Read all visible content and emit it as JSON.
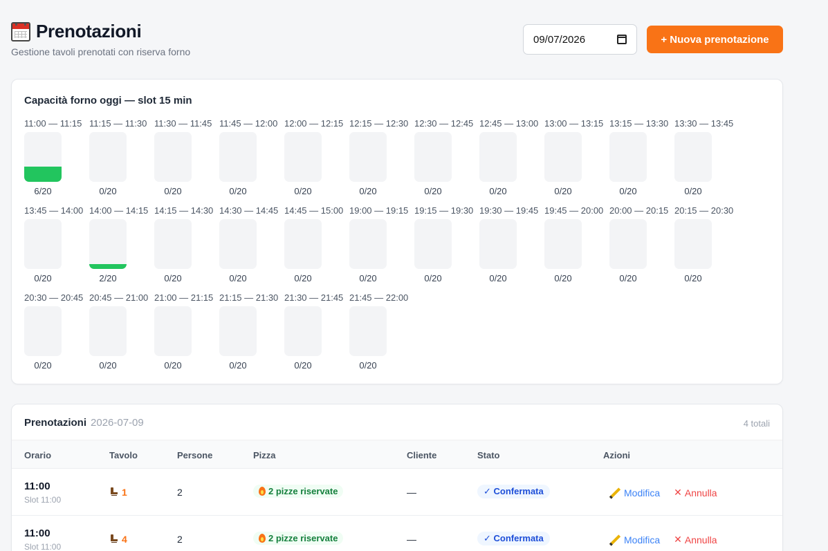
{
  "header": {
    "title": "Prenotazioni",
    "subtitle": "Gestione tavoli prenotati con riserva forno",
    "date_value": "09/07/2026",
    "new_button": "+ Nuova prenotazione"
  },
  "oven": {
    "title": "Capacità forno oggi — slot 15 min",
    "capacity": 20,
    "slots": [
      {
        "label": "11:00 — 11:15",
        "used": 6,
        "count": "6/20"
      },
      {
        "label": "11:15 — 11:30",
        "used": 0,
        "count": "0/20"
      },
      {
        "label": "11:30 — 11:45",
        "used": 0,
        "count": "0/20"
      },
      {
        "label": "11:45 — 12:00",
        "used": 0,
        "count": "0/20"
      },
      {
        "label": "12:00 — 12:15",
        "used": 0,
        "count": "0/20"
      },
      {
        "label": "12:15 — 12:30",
        "used": 0,
        "count": "0/20"
      },
      {
        "label": "12:30 — 12:45",
        "used": 0,
        "count": "0/20"
      },
      {
        "label": "12:45 — 13:00",
        "used": 0,
        "count": "0/20"
      },
      {
        "label": "13:00 — 13:15",
        "used": 0,
        "count": "0/20"
      },
      {
        "label": "13:15 — 13:30",
        "used": 0,
        "count": "0/20"
      },
      {
        "label": "13:30 — 13:45",
        "used": 0,
        "count": "0/20"
      },
      {
        "label": "13:45 — 14:00",
        "used": 0,
        "count": "0/20"
      },
      {
        "label": "14:00 — 14:15",
        "used": 2,
        "count": "2/20"
      },
      {
        "label": "14:15 — 14:30",
        "used": 0,
        "count": "0/20"
      },
      {
        "label": "14:30 — 14:45",
        "used": 0,
        "count": "0/20"
      },
      {
        "label": "14:45 — 15:00",
        "used": 0,
        "count": "0/20"
      },
      {
        "label": "19:00 — 19:15",
        "used": 0,
        "count": "0/20"
      },
      {
        "label": "19:15 — 19:30",
        "used": 0,
        "count": "0/20"
      },
      {
        "label": "19:30 — 19:45",
        "used": 0,
        "count": "0/20"
      },
      {
        "label": "19:45 — 20:00",
        "used": 0,
        "count": "0/20"
      },
      {
        "label": "20:00 — 20:15",
        "used": 0,
        "count": "0/20"
      },
      {
        "label": "20:15 — 20:30",
        "used": 0,
        "count": "0/20"
      },
      {
        "label": "20:30 — 20:45",
        "used": 0,
        "count": "0/20"
      },
      {
        "label": "20:45 — 21:00",
        "used": 0,
        "count": "0/20"
      },
      {
        "label": "21:00 — 21:15",
        "used": 0,
        "count": "0/20"
      },
      {
        "label": "21:15 — 21:30",
        "used": 0,
        "count": "0/20"
      },
      {
        "label": "21:30 — 21:45",
        "used": 0,
        "count": "0/20"
      },
      {
        "label": "21:45 — 22:00",
        "used": 0,
        "count": "0/20"
      }
    ],
    "fill_color": "#22c55e"
  },
  "reservations": {
    "title": "Prenotazioni",
    "date": "2026-07-09",
    "total": "4 totali",
    "columns": [
      "Orario",
      "Tavolo",
      "Persone",
      "Pizza",
      "Cliente",
      "Stato",
      "Azioni"
    ],
    "rows": [
      {
        "time": "11:00",
        "slot": "Slot 11:00",
        "table": "1",
        "people": "2",
        "pizza": "2 pizze riservate",
        "client": "—",
        "status": "✓ Confermata",
        "edit": "Modifica",
        "cancel": "Annulla"
      },
      {
        "time": "11:00",
        "slot": "Slot 11:00",
        "table": "4",
        "people": "2",
        "pizza": "2 pizze riservate",
        "client": "—",
        "status": "✓ Confermata",
        "edit": "Modifica",
        "cancel": "Annulla"
      }
    ]
  },
  "colors": {
    "accent": "#f97316",
    "confirmed": "#1d4ed8",
    "pizza": "#15803d",
    "cancel": "#ef4444",
    "edit": "#3b82f6"
  }
}
